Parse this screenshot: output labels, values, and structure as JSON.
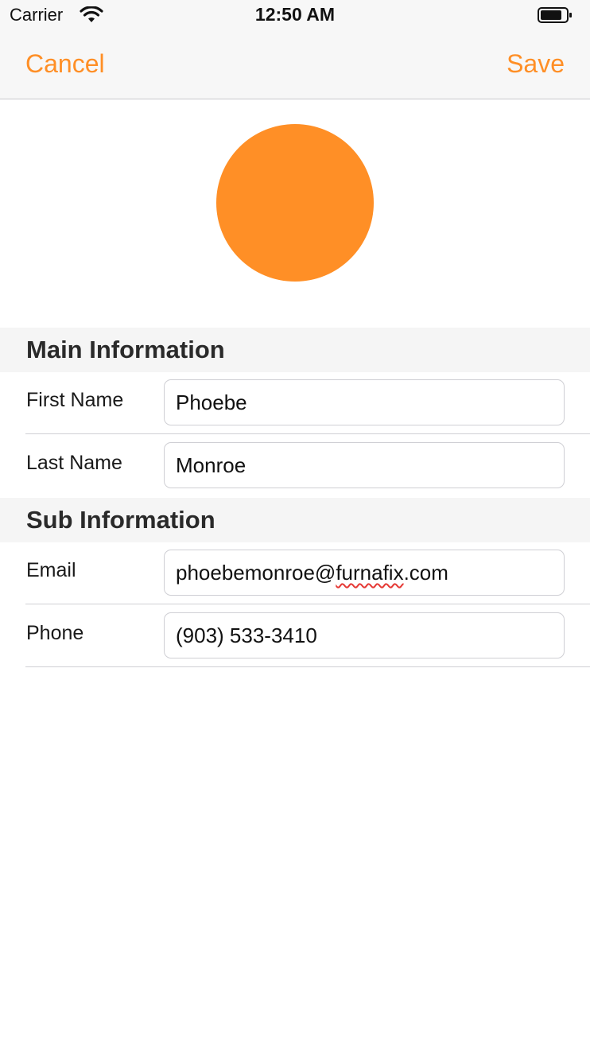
{
  "status_bar": {
    "carrier": "Carrier",
    "time": "12:50 AM",
    "icons": [
      "wifi-icon",
      "battery-icon"
    ]
  },
  "nav_bar": {
    "cancel_label": "Cancel",
    "save_label": "Save"
  },
  "colors": {
    "accent": "#ff8f26",
    "section_background": "#f5f5f5",
    "divider": "#d0d0d4"
  },
  "sections": [
    {
      "title": "Main Information",
      "rows": [
        {
          "label": "First Name",
          "value": "Phoebe"
        },
        {
          "label": "Last Name",
          "value": "Monroe"
        }
      ]
    },
    {
      "title": "Sub Information",
      "rows": [
        {
          "label": "Email",
          "value_prefix": "phoebemonroe@",
          "value_misspelled": "furnafix",
          "value_suffix": ".com"
        },
        {
          "label": "Phone",
          "value": "(903) 533-3410"
        }
      ]
    }
  ]
}
